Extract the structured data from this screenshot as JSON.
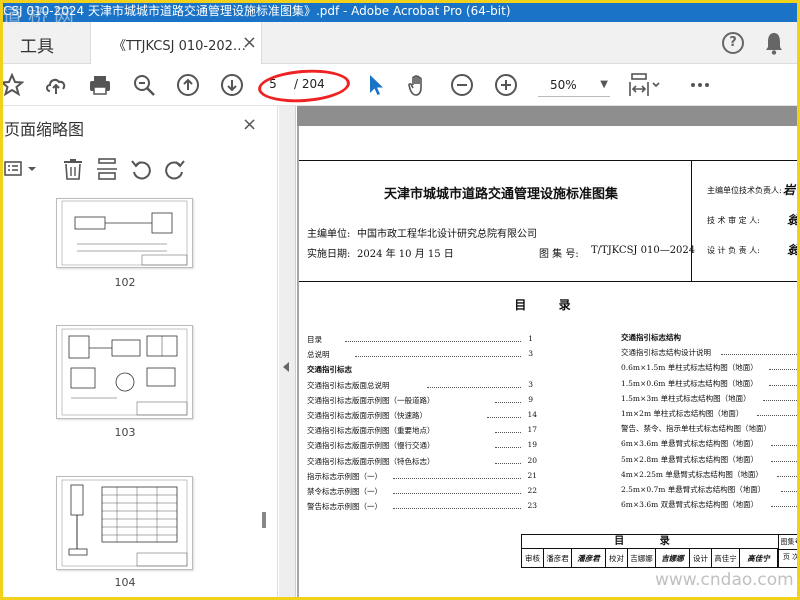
{
  "window": {
    "title": "CSJ 010-2024 天津市城城市道路交通管理设施标准图集》.pdf - Adobe Acrobat Pro (64-bit)"
  },
  "watermark": {
    "top": "道桥网",
    "bottom": "www.cndao.com"
  },
  "tabs": {
    "tools_label": "工具",
    "doc_label": "《TTJKCSJ 010-202…",
    "close": "×"
  },
  "toolbar": {
    "page_current": "5",
    "page_total": "/ 204",
    "zoom": "50%"
  },
  "sidebar": {
    "title": "页面缩略图",
    "close": "×",
    "thumbnails": [
      {
        "label": "102"
      },
      {
        "label": "103"
      },
      {
        "label": "104"
      }
    ]
  },
  "document": {
    "title": "天津市城城市道路交通管理设施标准图集",
    "editor_label": "主编单位:",
    "editor": "中国市政工程华北设计研究总院有限公司",
    "date_label": "实施日期:",
    "date": "2024 年 10 月 15 日",
    "atlas_label": "图 集 号:",
    "atlas_no": "T/TJKCSJ 010—2024",
    "signatures": [
      {
        "label": "主编单位技术负责人:",
        "mark": "岩"
      },
      {
        "label": "技 术 审 定 人:",
        "mark": "翁"
      },
      {
        "label": "设 计 负 责 人:",
        "mark": "翁"
      }
    ],
    "toc_title": "目 录",
    "toc_left": [
      {
        "text": "目录",
        "page": "1",
        "head": false
      },
      {
        "text": "总说明",
        "page": "3",
        "head": false
      },
      {
        "text": "交通指引标志",
        "page": "",
        "head": true
      },
      {
        "text": "交通指引标志版面总说明",
        "page": "3",
        "head": false
      },
      {
        "text": "交通指引标志版面示例图（一般道路）",
        "page": "9",
        "head": false
      },
      {
        "text": "交通指引标志版面示例图（快速路）",
        "page": "14",
        "head": false
      },
      {
        "text": "交通指引标志版面示例图（重要地点）",
        "page": "17",
        "head": false
      },
      {
        "text": "交通指引标志版面示例图（慢行交通）",
        "page": "19",
        "head": false
      },
      {
        "text": "交通指引标志版面示例图（特色标志）",
        "page": "20",
        "head": false
      },
      {
        "text": "指示标志示例图（一）",
        "page": "21",
        "head": false
      },
      {
        "text": "禁令标志示例图（一）",
        "page": "22",
        "head": false
      },
      {
        "text": "警告标志示例图（一）",
        "page": "23",
        "head": false
      }
    ],
    "toc_right": [
      {
        "text": "交通指引标志结构",
        "head": true
      },
      {
        "text": "交通指引标志结构设计说明",
        "head": false
      },
      {
        "text": "0.6m×1.5m 单柱式标志结构图（地面）",
        "head": false
      },
      {
        "text": "1.5m×0.6m 单柱式标志结构图（地面）",
        "head": false
      },
      {
        "text": "1.5m×3m 单柱式标志结构图（地面）",
        "head": false
      },
      {
        "text": "1m×2m 单柱式标志结构图（地面）",
        "head": false
      },
      {
        "text": "警告、禁令、指示单柱式标志结构图（地面）",
        "head": false
      },
      {
        "text": "6m×3.6m 单悬臂式标志结构图（地面）",
        "head": false
      },
      {
        "text": "5m×2.8m 单悬臂式标志结构图（地面）",
        "head": false
      },
      {
        "text": "4m×2.25m 单悬臂式标志结构图（地面）",
        "head": false
      },
      {
        "text": "2.5m×0.7m 单悬臂式标志结构图（地面）",
        "head": false
      },
      {
        "text": "6m×3.6m 双悬臂式标志结构图（地面）",
        "head": false
      }
    ],
    "title_block": {
      "heading": "目 录",
      "cells": [
        "审核",
        "潘彦君",
        "潘彦君",
        "校对",
        "吉娜娜",
        "吉娜娜",
        "设计",
        "高佳宁",
        "高佳宁"
      ],
      "right_top": "图集号",
      "right_bottom": "页 次"
    }
  }
}
